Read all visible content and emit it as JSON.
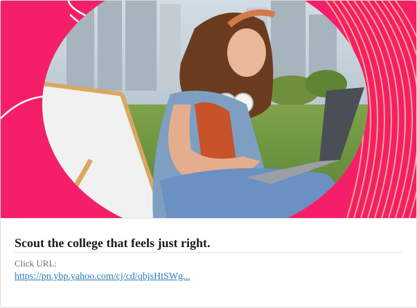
{
  "ad": {
    "headline": "Scout the college that feels just right.",
    "click_url_label": "Click URL:",
    "click_url": "https://pn.ybp.yahoo.com/cj/cd/qbjsHtSWg..."
  },
  "colors": {
    "brand_pink": "#f41f68",
    "stripe_orange": "#ffb38a",
    "link_blue": "#2a7ab8",
    "headline_text": "#1a1a1a"
  }
}
